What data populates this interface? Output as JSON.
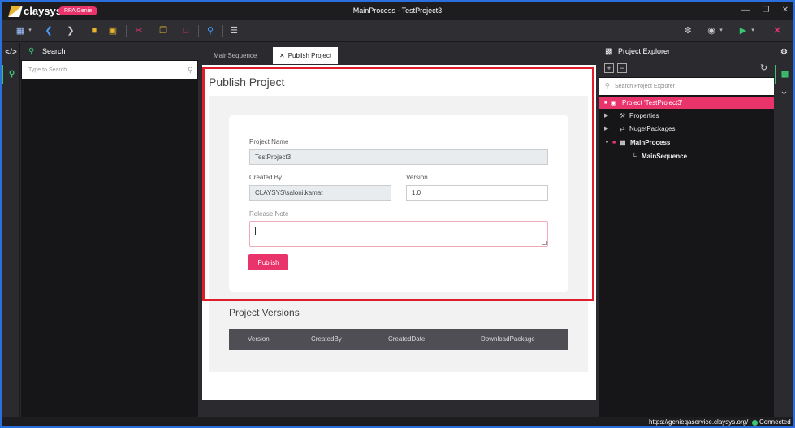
{
  "app": {
    "logo_text": "claysys",
    "badge": "RPA Genie",
    "window_title": "MainProcess - TestProject3"
  },
  "search_panel": {
    "title": "Search",
    "placeholder": "Type to Search"
  },
  "tabs": [
    {
      "label": "MainSequence",
      "active": false
    },
    {
      "label": "Publish Project",
      "active": true,
      "closable": true
    }
  ],
  "publish": {
    "title": "Publish Project",
    "project_name_label": "Project Name",
    "project_name_value": "TestProject3",
    "created_by_label": "Created By",
    "created_by_value": "CLAYSYS\\saloni.kamat",
    "version_label": "Version",
    "version_value": "1.0",
    "release_note_label": "Release Note",
    "release_note_value": "",
    "publish_button": "Publish"
  },
  "versions": {
    "title": "Project Versions",
    "columns": [
      "Version",
      "CreatedBy",
      "CreatedDate",
      "DownloadPackage"
    ]
  },
  "explorer": {
    "title": "Project Explorer",
    "placeholder": "Search Project Explorer",
    "tree": [
      {
        "label": "Project 'TestProject3'",
        "selected": true
      },
      {
        "label": "Properties"
      },
      {
        "label": "NugetPackages"
      },
      {
        "label": "MainProcess",
        "bold": true
      },
      {
        "label": "MainSequence",
        "bold": true
      }
    ]
  },
  "status": {
    "url": "https://genieqaservice.claysys.org/",
    "connection": "Connected"
  },
  "colors": {
    "accent": "#e8336b",
    "green": "#3cc473",
    "highlight": "#e01e2b",
    "frame": "#2a6fdb"
  }
}
